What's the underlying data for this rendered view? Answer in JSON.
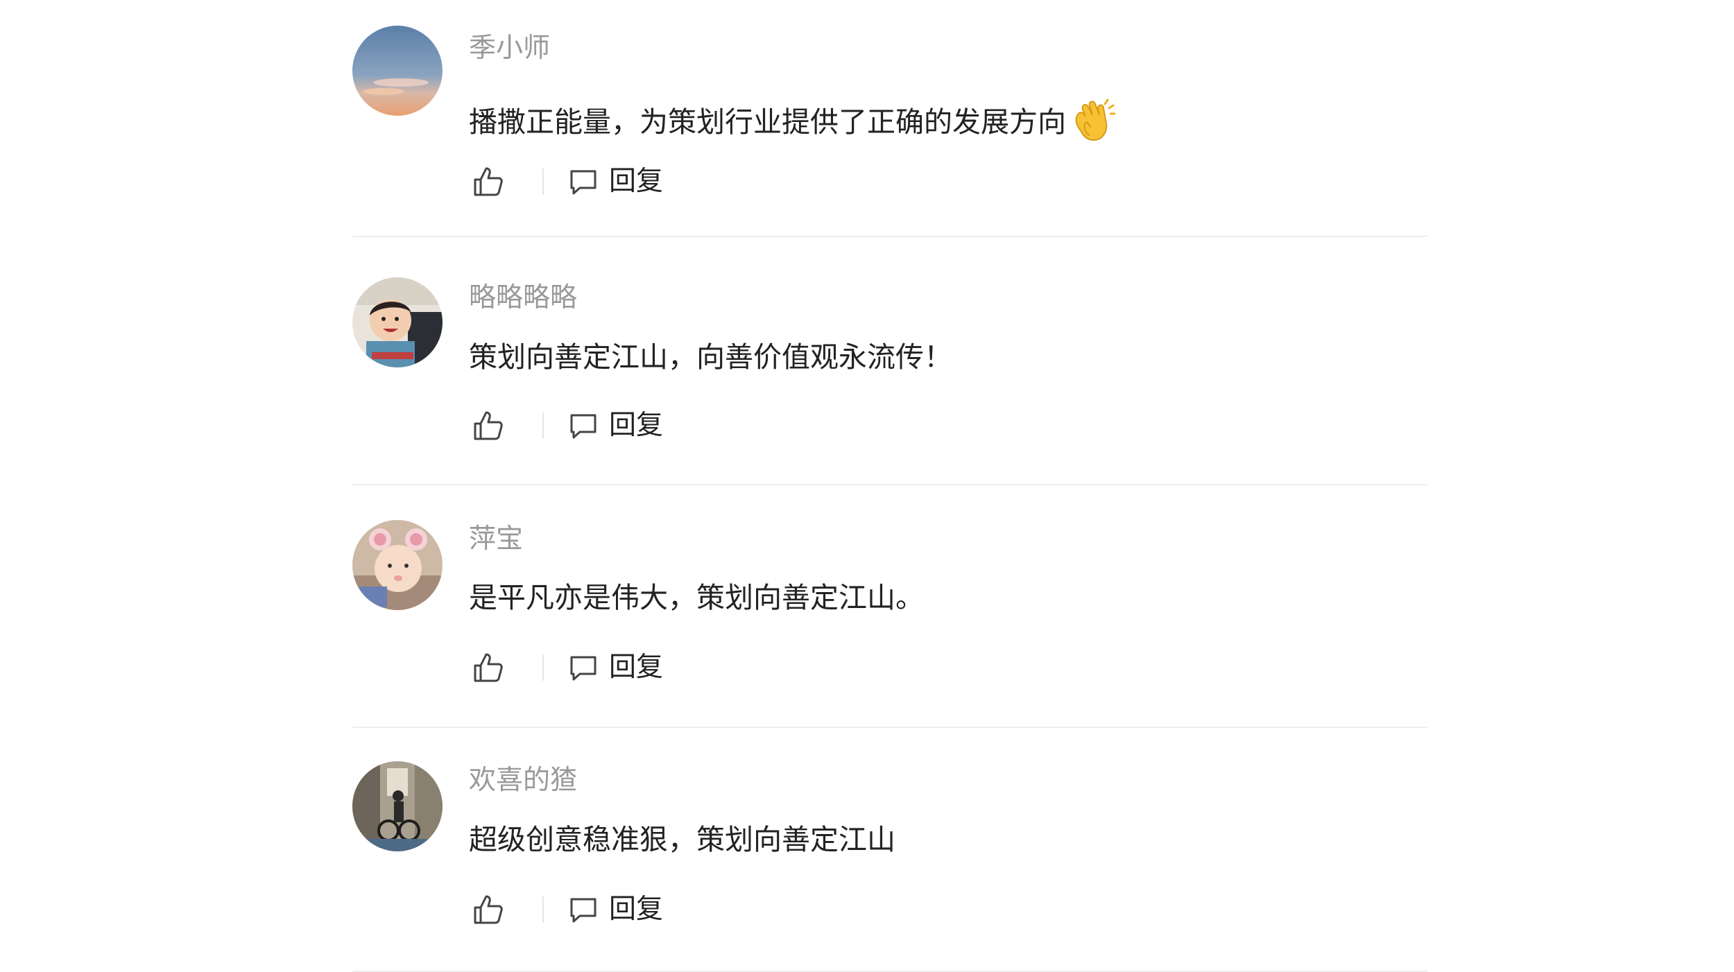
{
  "comments": [
    {
      "username": "季小师",
      "text": "播撒正能量，为策划行业提供了正确的发展方向",
      "emoji": "clapping-hands-icon",
      "reply_label": "回复"
    },
    {
      "username": "略略略略",
      "text": "策划向善定江山，向善价值观永流传！",
      "reply_label": "回复"
    },
    {
      "username": "萍宝",
      "text": "是平凡亦是伟大，策划向善定江山。",
      "reply_label": "回复"
    },
    {
      "username": "欢喜的猹",
      "text": "超级创意稳准狠，策划向善定江山",
      "reply_label": "回复"
    }
  ],
  "icons": {
    "like": "thumbs-up-icon",
    "reply": "speech-bubble-icon"
  },
  "colors": {
    "username": "#999999",
    "text": "#222222",
    "icon": "#444444",
    "divider": "#eeeeee"
  }
}
